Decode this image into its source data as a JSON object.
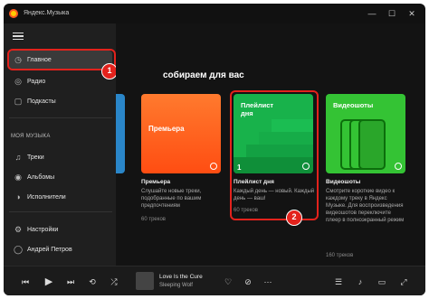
{
  "titlebar": {
    "title": "Яндекс.Музыка",
    "minimize": "—",
    "maximize": "☐",
    "close": "✕"
  },
  "sidebar": {
    "menu_icon": "hamburger-icon",
    "nav": [
      {
        "label": "Главное",
        "icon": "home-icon",
        "glyph": "◷"
      },
      {
        "label": "Радио",
        "icon": "radio-icon",
        "glyph": "◎"
      },
      {
        "label": "Подкасты",
        "icon": "podcast-icon",
        "glyph": "▢"
      }
    ],
    "section_title": "МОЯ МУЗЫКА",
    "my_music": [
      {
        "label": "Треки",
        "icon": "note-icon",
        "glyph": "♫"
      },
      {
        "label": "Альбомы",
        "icon": "album-icon",
        "glyph": "◉"
      },
      {
        "label": "Исполнители",
        "icon": "artist-icon",
        "glyph": "◑"
      }
    ],
    "settings": {
      "label": "Настройки",
      "icon": "gear-icon",
      "glyph": "⚙"
    },
    "user": {
      "label": "Андрей Петров",
      "icon": "user-icon",
      "glyph": "◯"
    }
  },
  "annotations": {
    "badge1": "1",
    "badge2": "2",
    "color": "#e3221c"
  },
  "main": {
    "heading": "собираем для вас",
    "cards": [
      {
        "cover_title": "Премьера",
        "title": "Премьера",
        "desc": "Слушайте новые треки, подобранные по вашим предпочтениям",
        "count": "60 треков",
        "color": "#ff5a1f"
      },
      {
        "cover_title": "Плейлист дня",
        "title": "Плейлист дня",
        "desc": "Каждый день — новый. Каждый день — ваш!",
        "count": "60 треков",
        "color": "#18b24b",
        "day_number": "1"
      },
      {
        "cover_title": "Видеошоты",
        "title": "Видеошоты",
        "desc": "Смотрите короткие видео к каждому треку в Яндекс Музыке. Для воспроизведения видеошотов переключите плеер в полноэкранный режим",
        "count": "160 треков",
        "color": "#32c832"
      }
    ]
  },
  "player": {
    "track_title": "Love Is the Cure",
    "track_artist": "Sleeping Wolf",
    "controls": [
      "prev-icon",
      "play-icon",
      "next-icon",
      "repeat-icon",
      "shuffle-icon"
    ]
  }
}
